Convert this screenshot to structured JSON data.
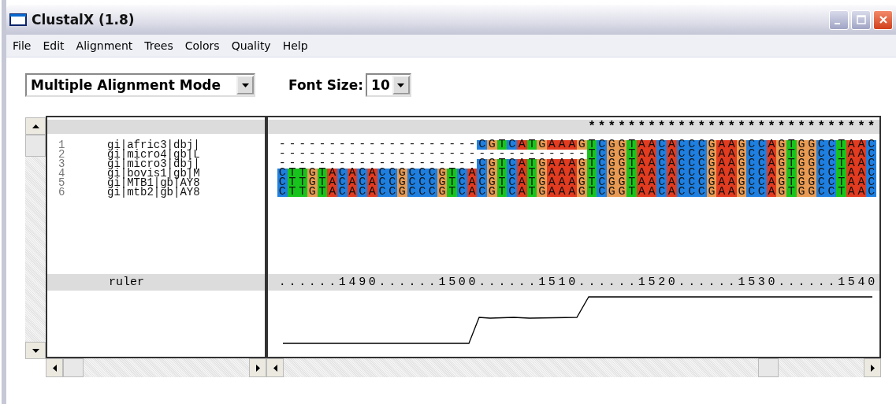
{
  "window": {
    "title": "ClustalX (1.8)"
  },
  "menu": [
    "File",
    "Edit",
    "Alignment",
    "Trees",
    "Colors",
    "Quality",
    "Help"
  ],
  "mode_select": {
    "value": "Multiple Alignment Mode"
  },
  "font_size": {
    "label": "Font Size:",
    "value": "10"
  },
  "alignment": {
    "conservation": "                               *****************************",
    "sequences": [
      {
        "number": "1",
        "name": "gi|afric3|dbj|",
        "residues": "--------------------CGTCATGAAAGTCGGTAACACCCGAAGCCAGTGGCCTAAC"
      },
      {
        "number": "2",
        "name": "gi|micro4|gb|L",
        "residues": "-------------------------------TCGGTAACACCCGAAGCCAGTGGCCTAAC"
      },
      {
        "number": "3",
        "name": "gi|micro3|dbj|",
        "residues": "--------------------CGTCATGAAAGTCGGTAACACCCGAAGCCAGTGGCCTAAC"
      },
      {
        "number": "4",
        "name": "gi|bovis1|gb|M",
        "residues": "CTTGTACACACCGCCCGTCACGTCATGAAAGTCGGTAACACCCGAAGCCAGTGGCCTAAC"
      },
      {
        "number": "5",
        "name": "gi|MTB1|gb|AY8",
        "residues": "CTTGTACACACCGCCCGTCACGTCATGAAAGTCGGTAACACCCGAAGCCAGTGGCCTAAC"
      },
      {
        "number": "6",
        "name": "gi|mtb2|gb|AY8",
        "residues": "CTTGTACACACCGCCCGTCACGTCATGAAAGTCGGTAACACCCGAAGCCAGTGGCCTAAC"
      }
    ],
    "ruler_label": "ruler",
    "ruler": "......1490......1500......1510......1520......1530......1540"
  }
}
